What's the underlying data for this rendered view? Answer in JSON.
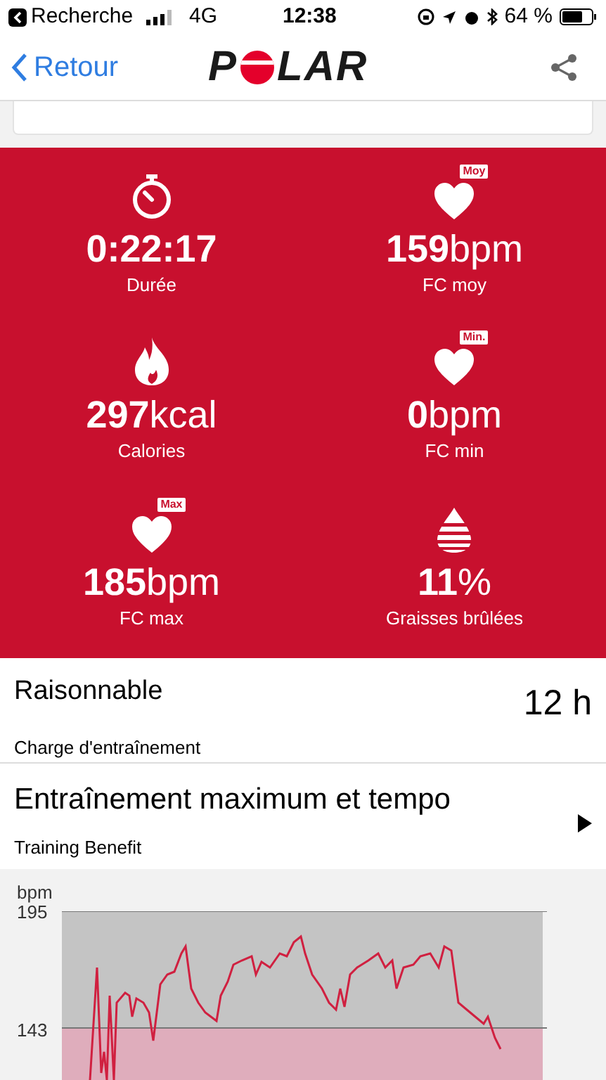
{
  "status_bar": {
    "back_app": "Recherche",
    "network": "4G",
    "time": "12:38",
    "battery": "64 %"
  },
  "nav": {
    "back": "Retour",
    "logo_before": "P",
    "logo_after": "LAR"
  },
  "stats": [
    {
      "kind": "stopwatch",
      "value": "0:22:17",
      "label": "Durée"
    },
    {
      "kind": "heart",
      "badge": "Moy",
      "value": "159",
      "unit": "bpm",
      "label": "FC moy"
    },
    {
      "kind": "flame",
      "value": "297",
      "unit": "kcal",
      "label": "Calories"
    },
    {
      "kind": "heart",
      "badge": "Min.",
      "value": "0",
      "unit": "bpm",
      "label": "FC min"
    },
    {
      "kind": "heart",
      "badge": "Max",
      "value": "185",
      "unit": "bpm",
      "label": "FC max"
    },
    {
      "kind": "fat",
      "value": "11",
      "unit": "%",
      "label": "Graisses brûlées"
    }
  ],
  "training_load": {
    "title": "Raisonnable",
    "value": "12 h",
    "subtitle": "Charge d'entraînement"
  },
  "training_benefit": {
    "title": "Entraînement maximum et tempo",
    "subtitle": "Training Benefit"
  },
  "heart_rate_chart": {
    "unit": "bpm",
    "ticks": [
      "195",
      "143"
    ]
  }
}
